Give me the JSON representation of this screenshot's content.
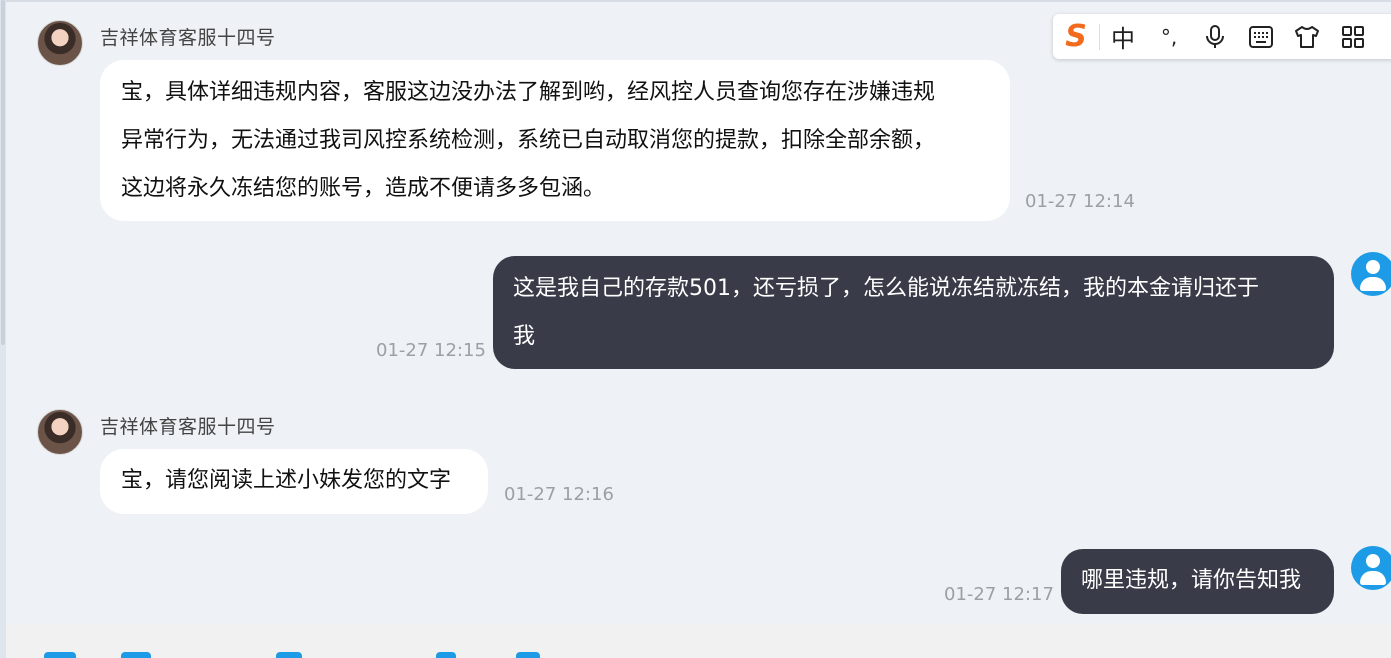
{
  "ime": {
    "logo": "S",
    "mode": "中",
    "punct": "°,",
    "voice_icon": "microphone-icon",
    "keyboard_icon": "keyboard-icon",
    "skin_icon": "shirt-icon",
    "apps_icon": "grid-icon"
  },
  "messages": [
    {
      "sender": "吉祥体育客服十四号",
      "lines": [
        "宝，具体详细违规内容，客服这边没办法了解到哟，经风控人员查询您存在涉嫌违规",
        "异常行为，无法通过我司风控系统检测，系统已自动取消您的提款，扣除全部余额，",
        "这边将永久冻结您的账号，造成不便请多多包涵。"
      ],
      "time": "01-27 12:14"
    },
    {
      "lines": [
        "这是我自己的存款501，还亏损了，怎么能说冻结就冻结，我的本金请归还于",
        "我"
      ],
      "time": "01-27 12:15"
    },
    {
      "sender": "吉祥体育客服十四号",
      "lines": [
        "宝，请您阅读上述小妹发您的文字"
      ],
      "time": "01-27 12:16"
    },
    {
      "lines": [
        "哪里违规，请你告知我"
      ],
      "time": "01-27 12:17"
    }
  ]
}
